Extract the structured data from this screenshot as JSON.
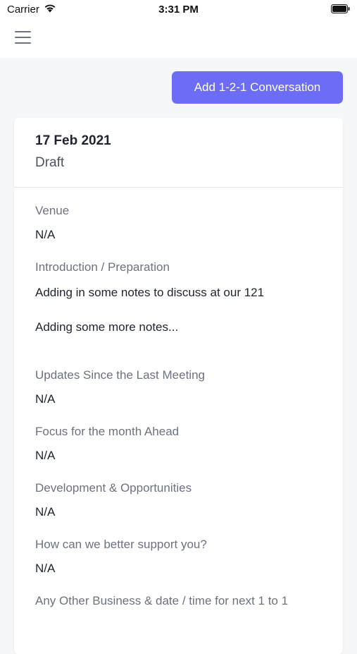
{
  "status_bar": {
    "carrier": "Carrier",
    "time": "3:31 PM"
  },
  "nav": {
    "menu_icon": "hamburger-menu-icon"
  },
  "actions": {
    "add_label": "Add 1-2-1 Conversation",
    "accent_color": "#6c6cf6"
  },
  "conversation": {
    "date": "17 Feb 2021",
    "status": "Draft",
    "fields": [
      {
        "label": "Venue",
        "value": "N/A"
      },
      {
        "label": "Introduction / Preparation",
        "value": "Adding in some notes to discuss at our 121\nAdding some more notes..."
      },
      {
        "label": "Updates Since the Last Meeting",
        "value": "N/A"
      },
      {
        "label": "Focus for the month Ahead",
        "value": "N/A"
      },
      {
        "label": "Development & Opportunities",
        "value": "N/A"
      },
      {
        "label": "How can we better support you?",
        "value": "N/A"
      },
      {
        "label": "Any Other Business & date / time for next 1 to 1",
        "value": ""
      }
    ]
  }
}
